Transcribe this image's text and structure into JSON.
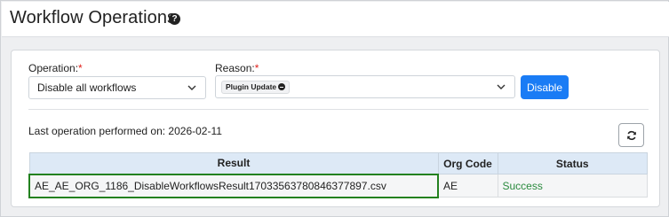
{
  "page": {
    "title": "Workflow Operations"
  },
  "form": {
    "operation_label": "Operation:",
    "operation_required": "*",
    "operation_value": "Disable all workflows",
    "reason_label": "Reason:",
    "reason_required": "*",
    "reason_tag": "Plugin Update",
    "disable_button": "Disable"
  },
  "last_operation": {
    "text": "Last operation performed on: 2026-02-11"
  },
  "results_table": {
    "columns": [
      "Result",
      "Org Code",
      "Status"
    ],
    "rows": [
      {
        "result": "AE_AE_ORG_1186_DisableWorkflowsResult17033563780846377897.csv",
        "org_code": "AE",
        "status": "Success"
      }
    ]
  },
  "icons": {
    "help": "question-circle-icon",
    "dropdown": "chevron-down-icon",
    "tag_remove": "minus-circle-icon",
    "refresh": "refresh-icon"
  },
  "colors": {
    "primary": "#1a7cf5",
    "required": "#e0201b",
    "success": "#2a8a3e",
    "table_header": "#dde9f6",
    "highlight_border": "#23811f"
  }
}
